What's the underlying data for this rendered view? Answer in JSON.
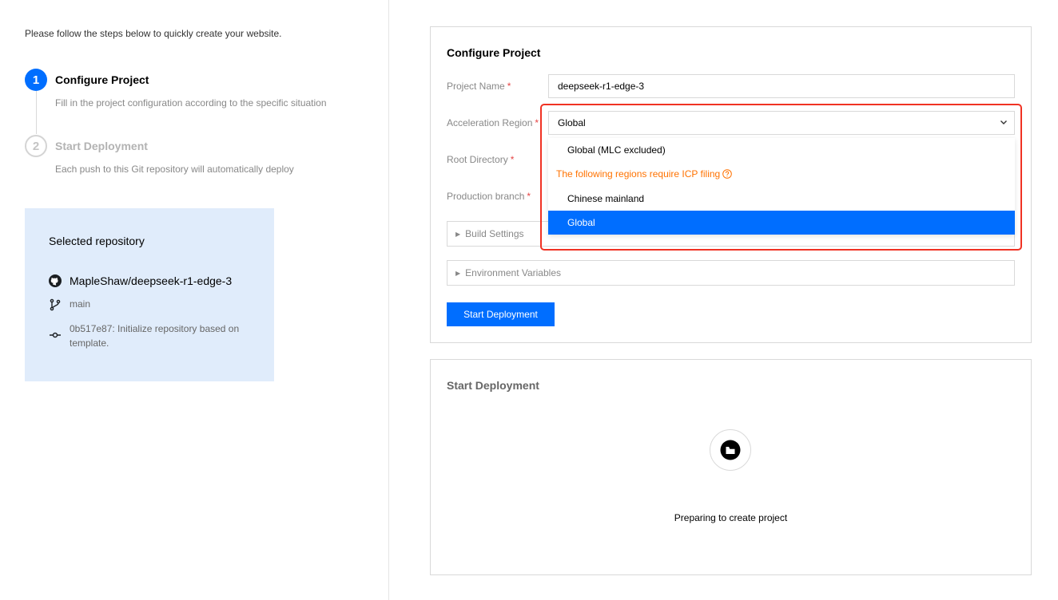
{
  "intro": "Please follow the steps below to quickly create your website.",
  "steps": [
    {
      "number": "1",
      "title": "Configure Project",
      "desc": "Fill in the project configuration according to the specific situation"
    },
    {
      "number": "2",
      "title": "Start Deployment",
      "desc": "Each push to this Git repository will automatically deploy"
    }
  ],
  "repo": {
    "title": "Selected repository",
    "name": "MapleShaw/deepseek-r1-edge-3",
    "branch": "main",
    "commit": "0b517e87: Initialize repository based on template."
  },
  "config": {
    "title": "Configure Project",
    "project_name_label": "Project Name",
    "project_name_value": "deepseek-r1-edge-3",
    "region_label": "Acceleration Region",
    "region_value": "Global",
    "root_label": "Root Directory",
    "branch_label": "Production branch",
    "required_mark": "*",
    "build_settings": "Build Settings",
    "env_vars": "Environment Variables",
    "deploy_button": "Start Deployment"
  },
  "dropdown": {
    "option_1": "Global (MLC excluded)",
    "group_label": "The following regions require ICP filing",
    "option_2": "Chinese mainland",
    "option_3": "Global"
  },
  "deploy": {
    "title": "Start Deployment",
    "status": "Preparing to create project"
  },
  "colors": {
    "primary": "#006eff",
    "warning": "#ff7200",
    "highlight": "#f03223",
    "repo_bg": "#e0ecfb"
  }
}
